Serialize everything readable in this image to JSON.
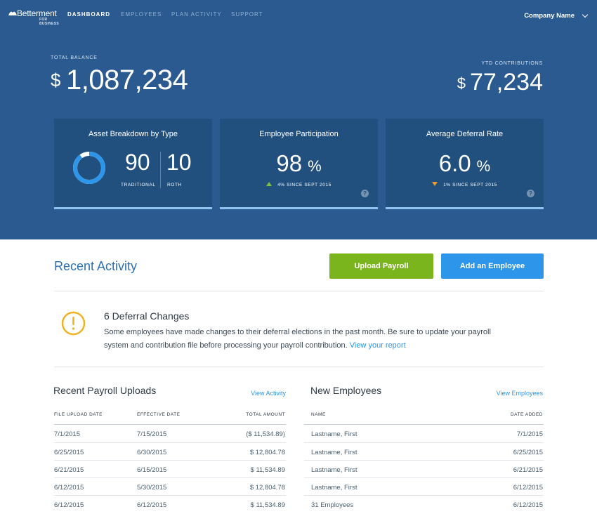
{
  "brand": {
    "name": "Betterment",
    "sub": "FOR BUSINESS"
  },
  "nav": {
    "items": [
      {
        "label": "DASHBOARD",
        "active": true
      },
      {
        "label": "EMPLOYEES",
        "active": false
      },
      {
        "label": "PLAN ACTIVITY",
        "active": false
      },
      {
        "label": "SUPPORT",
        "active": false
      }
    ],
    "company": "Company Name"
  },
  "summary": {
    "total_balance_label": "TOTAL BALANCE",
    "currency": "$",
    "total_balance": "1,087,234",
    "ytd_label": "YTD CONTRIBUTIONS",
    "ytd_value": "77,234"
  },
  "cards": {
    "asset": {
      "title": "Asset Breakdown by Type",
      "traditional_value": "90",
      "traditional_label": "TRADITIONAL",
      "roth_value": "10",
      "roth_label": "ROTH",
      "traditional_fraction": 0.9
    },
    "participation": {
      "title": "Employee Participation",
      "value": "98",
      "unit": "%",
      "delta": "4% SINCE SEPT 2015",
      "help": "?"
    },
    "deferral": {
      "title": "Average Deferral Rate",
      "value": "6.0",
      "unit": "%",
      "delta": "1% SINCE SEPT 2015",
      "help": "?"
    }
  },
  "activity": {
    "title": "Recent Activity",
    "upload_button": "Upload Payroll",
    "add_button": "Add an Employee"
  },
  "alert": {
    "title": "6 Deferral Changes",
    "body": "Some employees have made changes to their deferral elections in the past month. Be sure to update your payroll system and contribution file before processing your payroll contribution.",
    "link": "View your report"
  },
  "payroll": {
    "title": "Recent Payroll Uploads",
    "link": "View Activity",
    "headers": [
      "FILE UPLOAD DATE",
      "EFFECTIVE DATE",
      "TOTAL AMOUNT"
    ],
    "rows": [
      [
        "7/1/2015",
        "7/15/2015",
        "($ 11,534.89)"
      ],
      [
        "6/25/2015",
        "6/30/2015",
        "$ 12,804.78"
      ],
      [
        "6/21/2015",
        "6/15/2015",
        "$ 11,534.89"
      ],
      [
        "6/12/2015",
        "5/30/2015",
        "$ 12,804.78"
      ],
      [
        "6/12/2015",
        "6/12/2015",
        "$ 11,534.89"
      ]
    ]
  },
  "employees": {
    "title": "New Employees",
    "link": "View Employees",
    "headers": [
      "NAME",
      "DATE ADDED"
    ],
    "rows": [
      [
        "Lastname, First",
        "7/1/2015"
      ],
      [
        "Lastname, First",
        "6/25/2015"
      ],
      [
        "Lastname, First",
        "6/21/2015"
      ],
      [
        "Lastname, First",
        "6/12/2015"
      ],
      [
        "31 Employees",
        "6/12/2015"
      ]
    ]
  },
  "colors": {
    "hero_bg": "#2a5a8f",
    "card_bg": "#21507f",
    "accent_blue": "#2d96ea",
    "accent_green": "#7ab51d",
    "warning": "#f0b323"
  }
}
